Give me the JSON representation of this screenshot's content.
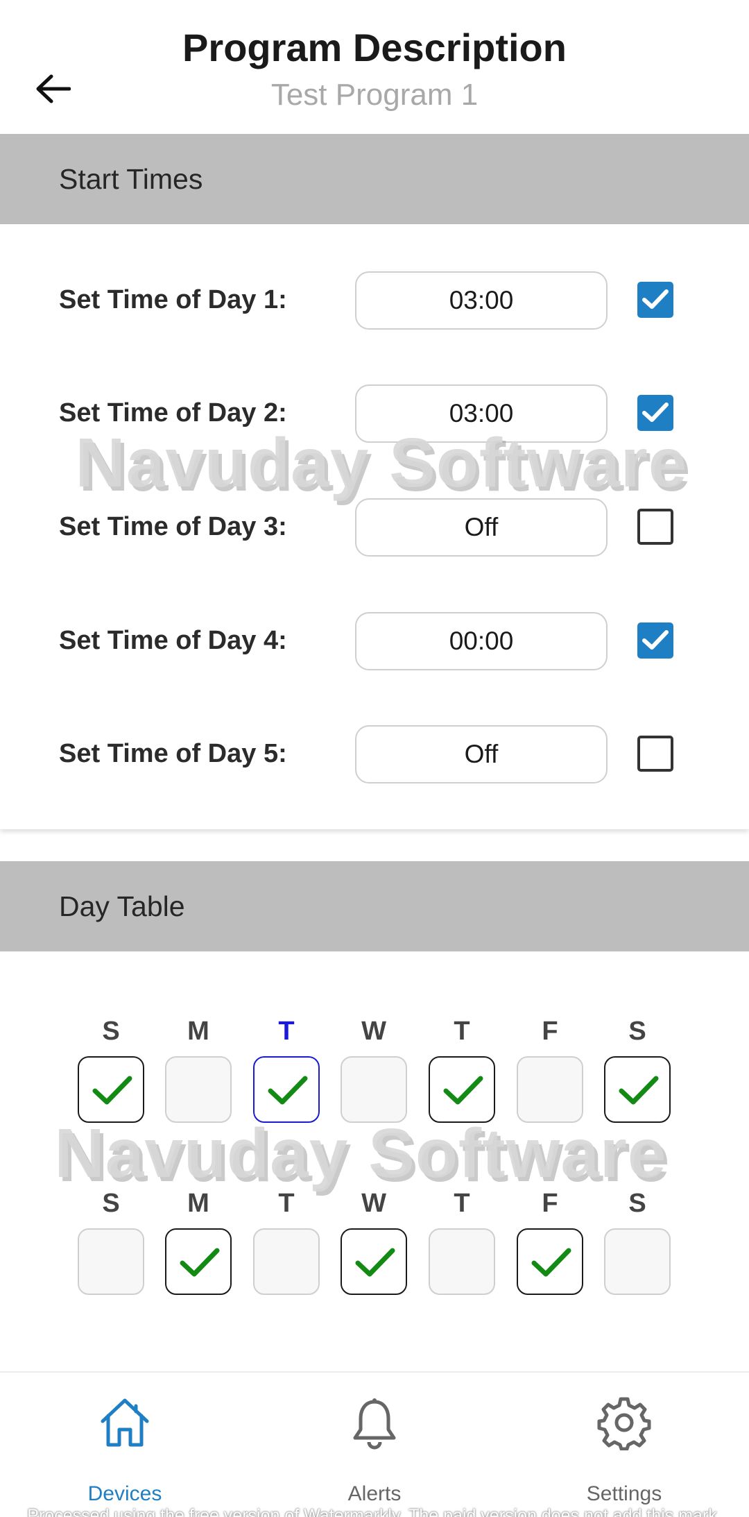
{
  "header": {
    "title": "Program Description",
    "subtitle": "Test Program 1",
    "back_icon": "arrow-left-icon"
  },
  "start_times": {
    "section_title": "Start Times",
    "rows": [
      {
        "label": "Set Time of Day 1:",
        "value": "03:00",
        "enabled": true
      },
      {
        "label": "Set Time of Day 2:",
        "value": "03:00",
        "enabled": true
      },
      {
        "label": "Set Time of Day 3:",
        "value": "Off",
        "enabled": false
      },
      {
        "label": "Set Time of Day 4:",
        "value": "00:00",
        "enabled": true
      },
      {
        "label": "Set Time of Day 5:",
        "value": "Off",
        "enabled": false
      }
    ]
  },
  "day_table": {
    "section_title": "Day Table",
    "weeks": [
      {
        "days": [
          {
            "letter": "S",
            "checked": true
          },
          {
            "letter": "M",
            "checked": false
          },
          {
            "letter": "T",
            "checked": true,
            "today": true
          },
          {
            "letter": "W",
            "checked": false
          },
          {
            "letter": "T",
            "checked": true
          },
          {
            "letter": "F",
            "checked": false
          },
          {
            "letter": "S",
            "checked": true
          }
        ]
      },
      {
        "days": [
          {
            "letter": "S",
            "checked": false
          },
          {
            "letter": "M",
            "checked": true
          },
          {
            "letter": "T",
            "checked": false
          },
          {
            "letter": "W",
            "checked": true
          },
          {
            "letter": "T",
            "checked": false
          },
          {
            "letter": "F",
            "checked": true
          },
          {
            "letter": "S",
            "checked": false
          }
        ]
      }
    ]
  },
  "watermark": {
    "text": "Navuday Software"
  },
  "bottom_nav": {
    "items": [
      {
        "label": "Devices",
        "icon": "home-icon",
        "active": true
      },
      {
        "label": "Alerts",
        "icon": "bell-icon",
        "active": false
      },
      {
        "label": "Settings",
        "icon": "gear-icon",
        "active": false
      }
    ]
  },
  "footer_note": "Processed using the free version of Watermarkly. The paid version does not add this mark.",
  "colors": {
    "accent": "#1f7fc4",
    "today": "#1a1ad6",
    "check_green": "#138a13",
    "section_header_bg": "#bdbdbd"
  }
}
